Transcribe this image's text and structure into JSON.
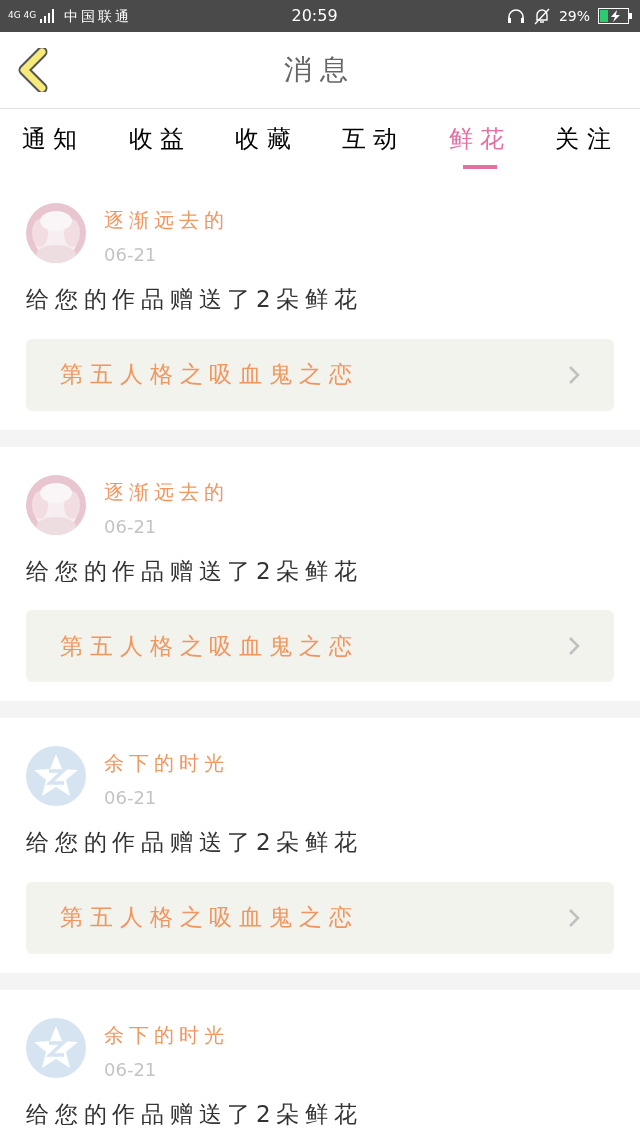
{
  "status_bar": {
    "network": "4G 4G",
    "carrier": "中国联通",
    "time": "20:59",
    "battery": "29%"
  },
  "header": {
    "title": "消息"
  },
  "tabs": [
    {
      "label": "通知",
      "selected": false
    },
    {
      "label": "收益",
      "selected": false
    },
    {
      "label": "收藏",
      "selected": false
    },
    {
      "label": "互动",
      "selected": false
    },
    {
      "label": "鲜花",
      "selected": true
    },
    {
      "label": "关注",
      "selected": false
    }
  ],
  "messages": [
    {
      "user": "逐渐远去的",
      "date": "06-21",
      "text": "给您的作品赠送了2朵鲜花",
      "work": "第五人格之吸血鬼之恋"
    },
    {
      "user": "逐渐远去的",
      "date": "06-21",
      "text": "给您的作品赠送了2朵鲜花",
      "work": "第五人格之吸血鬼之恋"
    },
    {
      "avatar": {
        "kind": "default"
      },
      "user": "余下的时光",
      "date": "06-21",
      "text": "给您的作品赠送了2朵鲜花",
      "work": "第五人格之吸血鬼之恋"
    },
    {
      "avatar": {
        "kind": "default"
      },
      "user": "余下的时光",
      "date": "06-21",
      "text": "给您的作品赠送了2朵鲜花"
    }
  ]
}
